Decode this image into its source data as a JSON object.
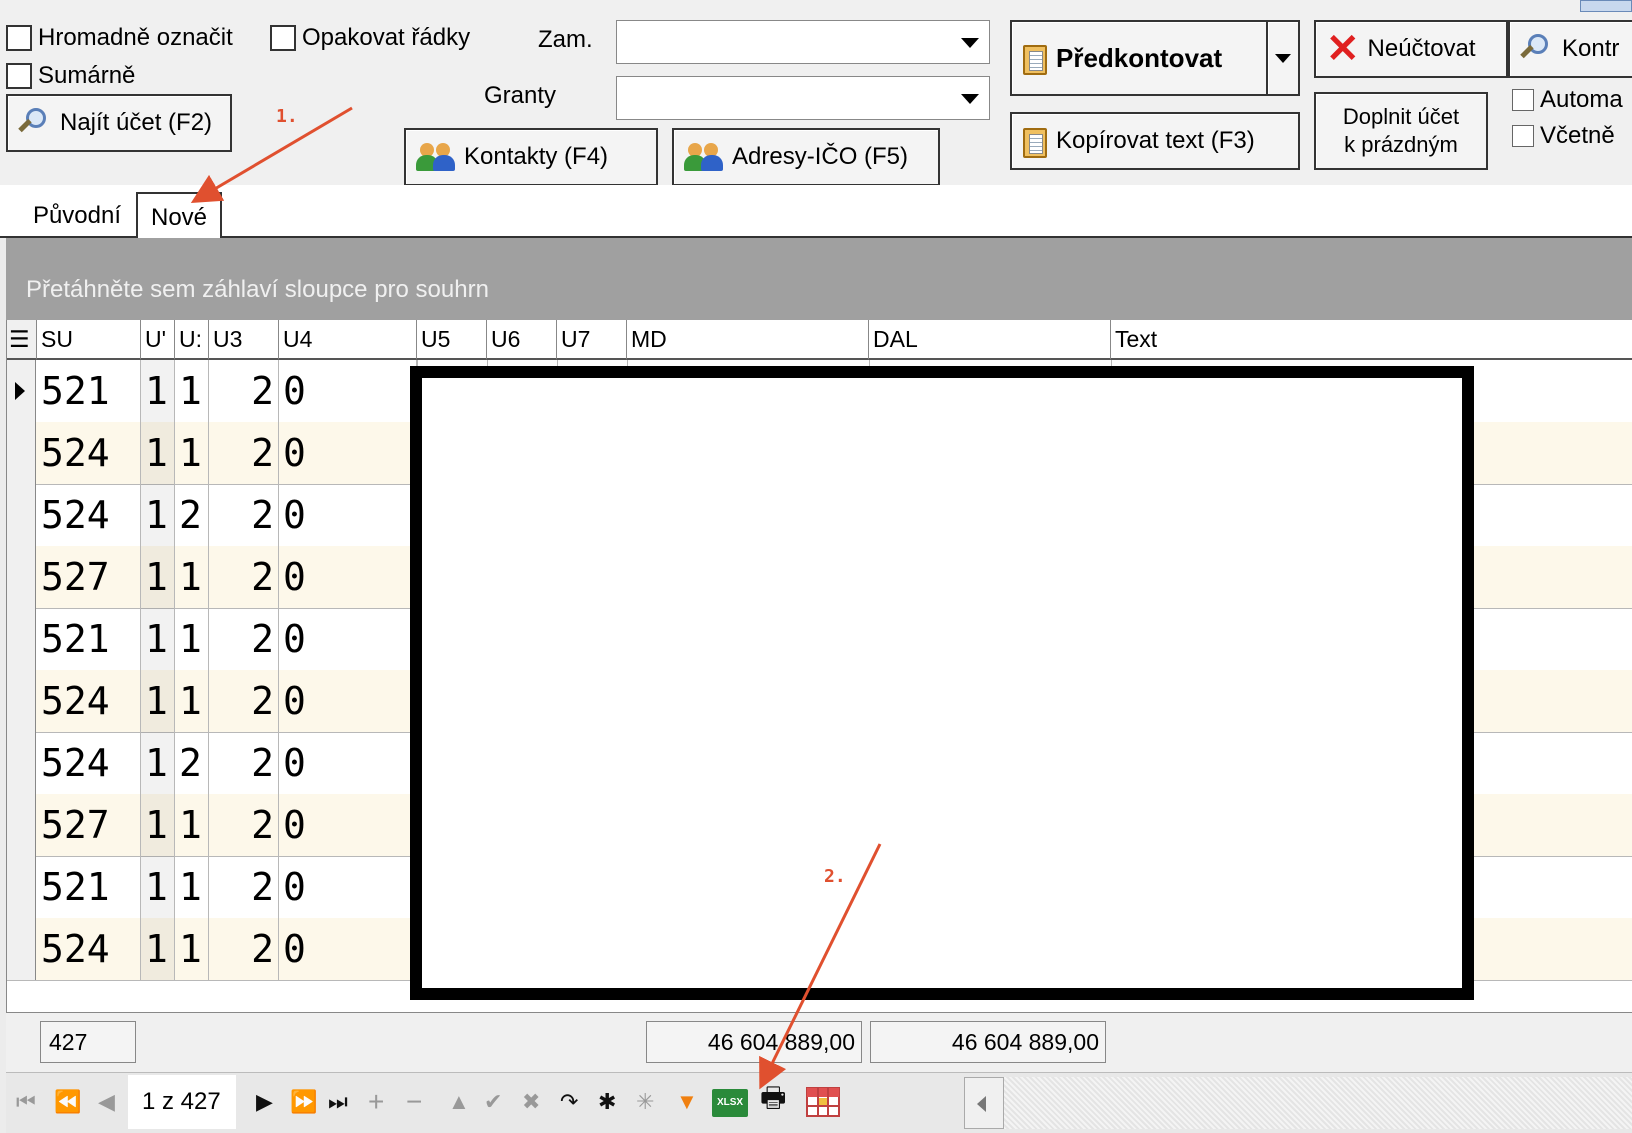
{
  "toolbar": {
    "mass_select_label": "Hromadně označit",
    "repeat_rows_label": "Opakovat řádky",
    "summary_label": "Sumárně",
    "find_account_label": "Najít účet (F2)",
    "employee_label": "Zam.",
    "employee_value": "",
    "grants_label": "Granty",
    "grants_value": "",
    "contacts_label": "Kontakty (F4)",
    "addresses_label": "Adresy-IČO (F5)",
    "prepost_label": "Předkontovat",
    "copy_text_label": "Kopírovat text (F3)",
    "no_account_label": "Neúčtovat",
    "control_label": "Kontr",
    "fill_account_line1": "Doplnit účet",
    "fill_account_line2": "k prázdným",
    "auto_label": "Automa",
    "including_label": "Včetně"
  },
  "tabs": [
    {
      "label": "Původní"
    },
    {
      "label": "Nové"
    }
  ],
  "grid": {
    "group_hint": "Přetáhněte sem záhlaví sloupce pro souhrn",
    "columns": [
      "SU",
      "U'",
      "U:",
      "U3",
      "U4",
      "U5",
      "U6",
      "U7",
      "MD",
      "DAL",
      "Text"
    ],
    "rows": [
      {
        "su": "521",
        "u1": "1",
        "u2": "1",
        "u3": "2",
        "u4": "0"
      },
      {
        "su": "524",
        "u1": "1",
        "u2": "1",
        "u3": "2",
        "u4": "0"
      },
      {
        "su": "524",
        "u1": "1",
        "u2": "2",
        "u3": "2",
        "u4": "0"
      },
      {
        "su": "527",
        "u1": "1",
        "u2": "1",
        "u3": "2",
        "u4": "0"
      },
      {
        "su": "521",
        "u1": "1",
        "u2": "1",
        "u3": "2",
        "u4": "0"
      },
      {
        "su": "524",
        "u1": "1",
        "u2": "1",
        "u3": "2",
        "u4": "0"
      },
      {
        "su": "524",
        "u1": "1",
        "u2": "2",
        "u3": "2",
        "u4": "0"
      },
      {
        "su": "527",
        "u1": "1",
        "u2": "1",
        "u3": "2",
        "u4": "0"
      },
      {
        "su": "521",
        "u1": "1",
        "u2": "1",
        "u3": "2",
        "u4": "0"
      },
      {
        "su": "524",
        "u1": "1",
        "u2": "1",
        "u3": "2",
        "u4": "0"
      }
    ]
  },
  "footer": {
    "count": "427",
    "md_sum": "46 604 889,00",
    "dal_sum": "46 604 889,00"
  },
  "navigator": {
    "page_info": "1 z 427",
    "xlsx_label": "XLSX"
  },
  "annotations": {
    "step1": "1.",
    "step2": "2.",
    "color": "#e0502f"
  }
}
